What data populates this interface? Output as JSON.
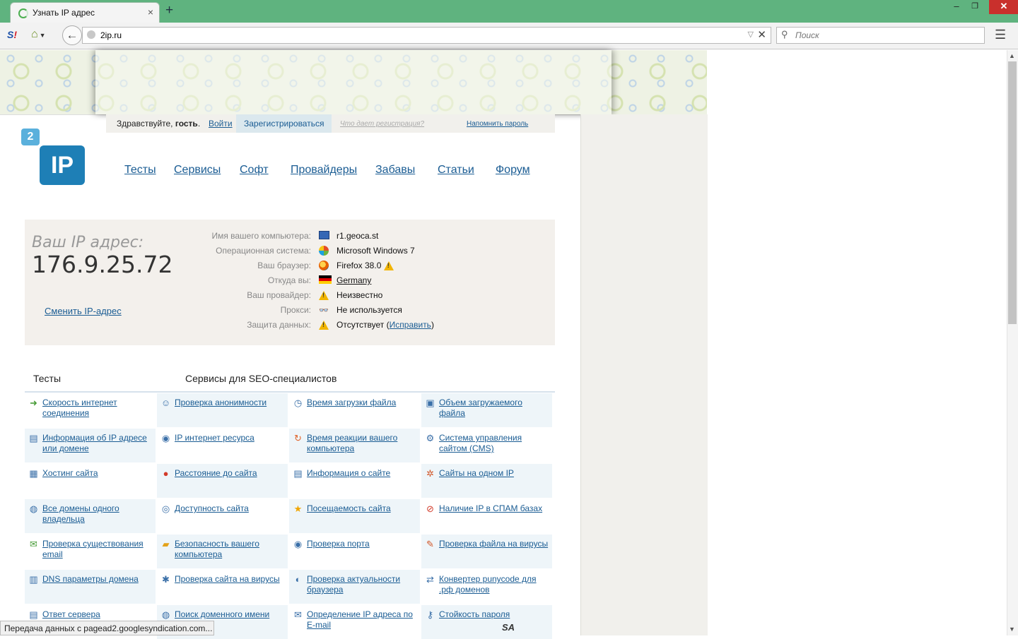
{
  "browser": {
    "tab_title": "Узнать IP адрес",
    "tab_close": "×",
    "new_tab": "+",
    "window_min": "–",
    "window_max": "❐",
    "window_close": "✕",
    "url": "2ip.ru",
    "search_placeholder": "Поиск",
    "status_text": "Передача данных с pagead2.googlesyndication.com...",
    "accent_color": "#5fb37f"
  },
  "site": {
    "logo_small": "2",
    "logo_big": "IP",
    "login_bar": {
      "greeting_prefix": "Здравствуйте, ",
      "greeting_user": "гость",
      "greeting_suffix": ".",
      "login": "Войти",
      "register": "Зарегистрироваться",
      "why_register": "Что дает регистрация?",
      "remind_password": "Напомнить пароль"
    },
    "nav": [
      {
        "label": "Тесты"
      },
      {
        "label": "Сервисы"
      },
      {
        "label": "Софт"
      },
      {
        "label": "Провайдеры"
      },
      {
        "label": "Забавы"
      },
      {
        "label": "Статьи"
      },
      {
        "label": "Форум"
      }
    ]
  },
  "ip_info": {
    "label": "Ваш IP адрес:",
    "ip": "176.9.25.72",
    "change_ip": "Сменить IP-адрес",
    "rows": [
      {
        "key": "Имя вашего компьютера:",
        "value": "r1.geoca.st",
        "icon": "computer-icon"
      },
      {
        "key": "Операционная система:",
        "value": "Microsoft Windows 7",
        "icon": "windows-icon"
      },
      {
        "key": "Ваш браузер:",
        "value": "Firefox 38.0",
        "icon": "firefox-icon"
      },
      {
        "key": "Откуда вы:",
        "value": "Germany",
        "icon": "flag-germany-icon"
      },
      {
        "key": "Ваш провайдер:",
        "value": "Неизвестно",
        "icon": "warning-icon"
      },
      {
        "key": "Прокси:",
        "value": "Не используется",
        "icon": "glasses-icon"
      },
      {
        "key": "Защита данных:",
        "value": "Отсутствует (",
        "link": "Исправить",
        "suffix": ")",
        "icon": "warning-icon"
      }
    ]
  },
  "sections": {
    "tests": "Тесты",
    "seo": "Сервисы для SEO-специалистов"
  },
  "services": [
    {
      "label": "Скорость интернет соединения",
      "icon": "speed-arrow-icon"
    },
    {
      "label": "Проверка анонимности",
      "icon": "user-icon"
    },
    {
      "label": "Время загрузки файла",
      "icon": "clock-icon"
    },
    {
      "label": "Объем загружаемого файла",
      "icon": "file-size-icon"
    },
    {
      "label": "Информация об IP адресе или домене",
      "icon": "ip-badge-icon"
    },
    {
      "label": "IP интернет ресурса",
      "icon": "ip-globe-icon"
    },
    {
      "label": "Время реакции вашего компьютера",
      "icon": "refresh-icon"
    },
    {
      "label": "Система управления сайтом (CMS)",
      "icon": "gear-icon"
    },
    {
      "label": "Хостинг сайта",
      "icon": "server-icon"
    },
    {
      "label": "Расстояние до сайта",
      "icon": "map-pin-icon"
    },
    {
      "label": "Информация о сайте",
      "icon": "document-icon"
    },
    {
      "label": "Сайты на одном IP",
      "icon": "network-icon"
    },
    {
      "label": "Все домены одного владельца",
      "icon": "globe-user-icon"
    },
    {
      "label": "Доступность сайта",
      "icon": "globe-check-icon"
    },
    {
      "label": "Посещаемость сайта",
      "icon": "star-icon"
    },
    {
      "label": "Наличие IP в СПАМ базах",
      "icon": "block-icon"
    },
    {
      "label": "Проверка существования email",
      "icon": "mail-icon"
    },
    {
      "label": "Безопасность вашего компьютера",
      "icon": "lock-icon"
    },
    {
      "label": "Проверка порта",
      "icon": "globe-port-icon"
    },
    {
      "label": "Проверка файла на вирусы",
      "icon": "virus-file-icon"
    },
    {
      "label": "DNS параметры домена",
      "icon": "dns-icon"
    },
    {
      "label": "Проверка сайта на вирусы",
      "icon": "bug-icon"
    },
    {
      "label": "Проверка актуальности браузера",
      "icon": "browser-icon"
    },
    {
      "label": "Конвертер punycode для .рф доменов",
      "icon": "convert-icon"
    },
    {
      "label": "Ответ сервера",
      "icon": "server-response-icon"
    },
    {
      "label": "Поиск доменного имени",
      "icon": "search-globe-icon"
    },
    {
      "label": "Определение IP адреса по E-mail",
      "icon": "mail-ip-icon"
    },
    {
      "label": "Стойкость пароля",
      "icon": "key-icon"
    }
  ],
  "footer_mark": "SA"
}
